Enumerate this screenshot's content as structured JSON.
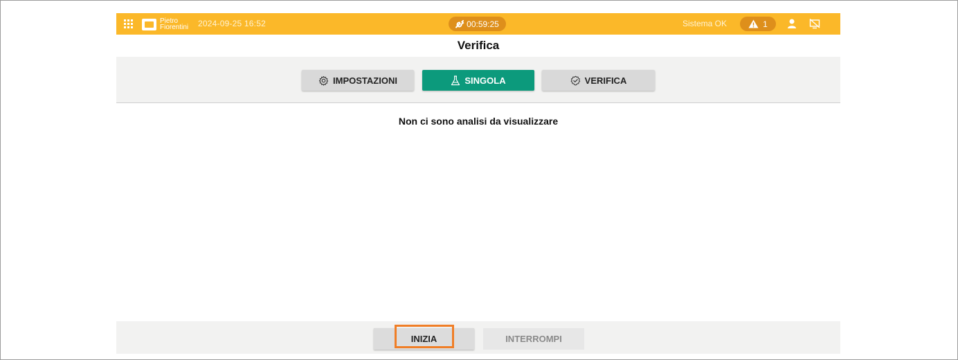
{
  "header": {
    "logo_line1": "Pietro",
    "logo_line2": "Fiorentini",
    "datetime": "2024-09-25 16:52",
    "timer": "00:59:25",
    "system_status": "Sistema OK",
    "alert_count": "1",
    "icons": [
      "apps-grid-icon",
      "wrench-icon",
      "warning-icon",
      "user-icon",
      "display-off-icon"
    ]
  },
  "page": {
    "title": "Verifica"
  },
  "tabs": [
    {
      "label": "IMPOSTAZIONI",
      "icon": "gear-icon",
      "active": false
    },
    {
      "label": "SINGOLA",
      "icon": "flask-icon",
      "active": true
    },
    {
      "label": "VERIFICA",
      "icon": "check-badge-icon",
      "active": false
    }
  ],
  "content": {
    "empty_message": "Non ci sono analisi da visualizzare"
  },
  "actions": {
    "start_label": "INIZIA",
    "stop_label": "INTERROMPI"
  },
  "colors": {
    "topbar": "#fbb829",
    "pill": "#de8f1b",
    "active_tab": "#0c9a7c",
    "highlight": "#f07e26"
  }
}
